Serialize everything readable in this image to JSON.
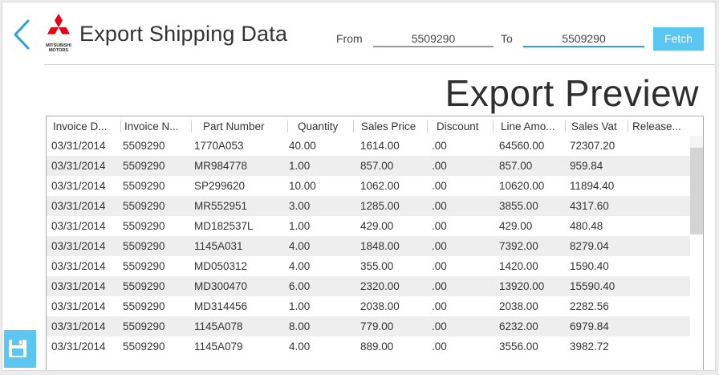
{
  "header": {
    "title": "Export Shipping Data",
    "logo_text_line1": "MITSUBISHI",
    "logo_text_line2": "MOTORS",
    "back_icon": "chevron-left-icon"
  },
  "filters": {
    "from_label": "From",
    "from_value": "5509290",
    "to_label": "To",
    "to_value": "5509290",
    "fetch_label": "Fetch"
  },
  "preview": {
    "title": "Export Preview"
  },
  "table": {
    "columns": [
      "Invoice D...",
      "Invoice N...",
      "Part Number",
      "Quantity",
      "Sales Price",
      "Discount",
      "Line Amo...",
      "Sales Vat",
      "Release..."
    ],
    "rows": [
      [
        "03/31/2014",
        "5509290",
        "1770A053",
        "40.00",
        "1614.00",
        ".00",
        "64560.00",
        "72307.20",
        ""
      ],
      [
        "03/31/2014",
        "5509290",
        "MR984778",
        "1.00",
        "857.00",
        ".00",
        "857.00",
        "959.84",
        ""
      ],
      [
        "03/31/2014",
        "5509290",
        "SP299620",
        "10.00",
        "1062.00",
        ".00",
        "10620.00",
        "11894.40",
        ""
      ],
      [
        "03/31/2014",
        "5509290",
        "MR552951",
        "3.00",
        "1285.00",
        ".00",
        "3855.00",
        "4317.60",
        ""
      ],
      [
        "03/31/2014",
        "5509290",
        "MD182537L",
        "1.00",
        "429.00",
        ".00",
        "429.00",
        "480.48",
        ""
      ],
      [
        "03/31/2014",
        "5509290",
        "1145A031",
        "4.00",
        "1848.00",
        ".00",
        "7392.00",
        "8279.04",
        ""
      ],
      [
        "03/31/2014",
        "5509290",
        "MD050312",
        "4.00",
        "355.00",
        ".00",
        "1420.00",
        "1590.40",
        ""
      ],
      [
        "03/31/2014",
        "5509290",
        "MD300470",
        "6.00",
        "2320.00",
        ".00",
        "13920.00",
        "15590.40",
        ""
      ],
      [
        "03/31/2014",
        "5509290",
        "MD314456",
        "1.00",
        "2038.00",
        ".00",
        "2038.00",
        "2282.56",
        ""
      ],
      [
        "03/31/2014",
        "5509290",
        "1145A078",
        "8.00",
        "779.00",
        ".00",
        "6232.00",
        "6979.84",
        ""
      ],
      [
        "03/31/2014",
        "5509290",
        "1145A079",
        "4.00",
        "889.00",
        ".00",
        "3556.00",
        "3982.72",
        ""
      ]
    ]
  },
  "colors": {
    "accent": "#5bc7f1",
    "active_underline": "#29a3d9",
    "brand_red": "#e60012",
    "row_alt": "#eeeeee"
  },
  "save_icon": "floppy-disk-icon"
}
